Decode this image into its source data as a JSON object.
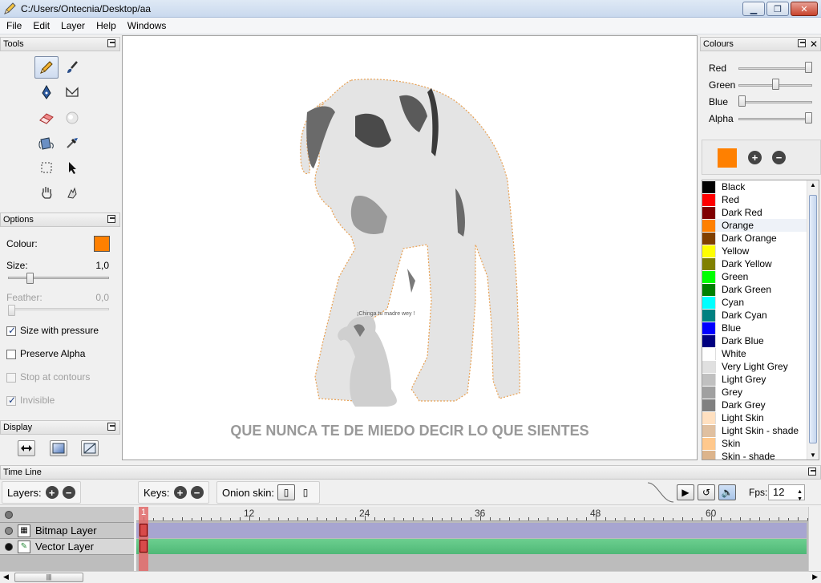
{
  "window": {
    "title": "C:/Users/Ontecnia/Desktop/aa",
    "minimize_label": "▁",
    "maximize_label": "❐",
    "close_label": "✕"
  },
  "menu": [
    "File",
    "Edit",
    "Layer",
    "Help",
    "Windows"
  ],
  "tools": {
    "title": "Tools",
    "items": [
      "pencil-icon",
      "brush-icon",
      "pen-icon",
      "polyline-icon",
      "eraser-icon",
      "smudge-icon",
      "bucket-icon",
      "eyedropper-icon",
      "select-icon",
      "pointer-icon",
      "hand-icon",
      "smudge-hand-icon"
    ]
  },
  "options": {
    "title": "Options",
    "colour_label": "Colour:",
    "colour_value": "#ff8000",
    "size_label": "Size:",
    "size_value": "1,0",
    "size_level": 0.2,
    "feather_label": "Feather:",
    "feather_value": "0,0",
    "feather_level": 0.0,
    "size_pressure_label": "Size with pressure",
    "size_pressure_checked": true,
    "preserve_alpha_label": "Preserve Alpha",
    "preserve_alpha_checked": false,
    "stop_contours_label": "Stop at contours",
    "stop_contours_checked": false,
    "invisible_label": "Invisible",
    "invisible_checked": true
  },
  "display": {
    "title": "Display",
    "items": [
      "flip-horizontal-icon",
      "gradient-icon",
      "diagonal-icon"
    ]
  },
  "canvas": {
    "caption": "QUE NUNCA TE DE MIEDO DECIR LO QUE SIENTES",
    "small_text": "¡Chinga tu madre wey !"
  },
  "colours": {
    "title": "Colours",
    "red_label": "Red",
    "red_level": 1.0,
    "green_label": "Green",
    "green_level": 0.5,
    "blue_label": "Blue",
    "blue_level": 0.0,
    "alpha_label": "Alpha",
    "alpha_level": 1.0,
    "current": "#ff8000",
    "list": [
      {
        "name": "Black",
        "color": "#000000"
      },
      {
        "name": "Red",
        "color": "#ff0000"
      },
      {
        "name": "Dark Red",
        "color": "#800000"
      },
      {
        "name": "Orange",
        "color": "#ff8000"
      },
      {
        "name": "Dark Orange",
        "color": "#804000"
      },
      {
        "name": "Yellow",
        "color": "#ffff00"
      },
      {
        "name": "Dark Yellow",
        "color": "#808000"
      },
      {
        "name": "Green",
        "color": "#00ff00"
      },
      {
        "name": "Dark Green",
        "color": "#008000"
      },
      {
        "name": "Cyan",
        "color": "#00ffff"
      },
      {
        "name": "Dark Cyan",
        "color": "#008080"
      },
      {
        "name": "Blue",
        "color": "#0000ff"
      },
      {
        "name": "Dark Blue",
        "color": "#000080"
      },
      {
        "name": "White",
        "color": "#ffffff"
      },
      {
        "name": "Very Light Grey",
        "color": "#e0e0e0"
      },
      {
        "name": "Light Grey",
        "color": "#c0c0c0"
      },
      {
        "name": "Grey",
        "color": "#a0a0a0"
      },
      {
        "name": "Dark Grey",
        "color": "#808080"
      },
      {
        "name": "Light Skin",
        "color": "#ffe0c0"
      },
      {
        "name": "Light Skin - shade",
        "color": "#e0c0a0"
      },
      {
        "name": "Skin",
        "color": "#ffc88c"
      },
      {
        "name": "Skin - shade",
        "color": "#dcb48c"
      }
    ]
  },
  "timeline": {
    "title": "Time Line",
    "layers_label": "Layers:",
    "keys_label": "Keys:",
    "onion_label": "Onion skin:",
    "fps_label": "Fps:",
    "fps_value": "12",
    "current_frame": "1",
    "ruler_labels": [
      "12",
      "24",
      "36",
      "48",
      "60"
    ],
    "layers": [
      {
        "name": "Bitmap Layer",
        "color": "#a7a5d0"
      },
      {
        "name": "Vector Layer",
        "color": "#6ccf8f"
      }
    ]
  }
}
